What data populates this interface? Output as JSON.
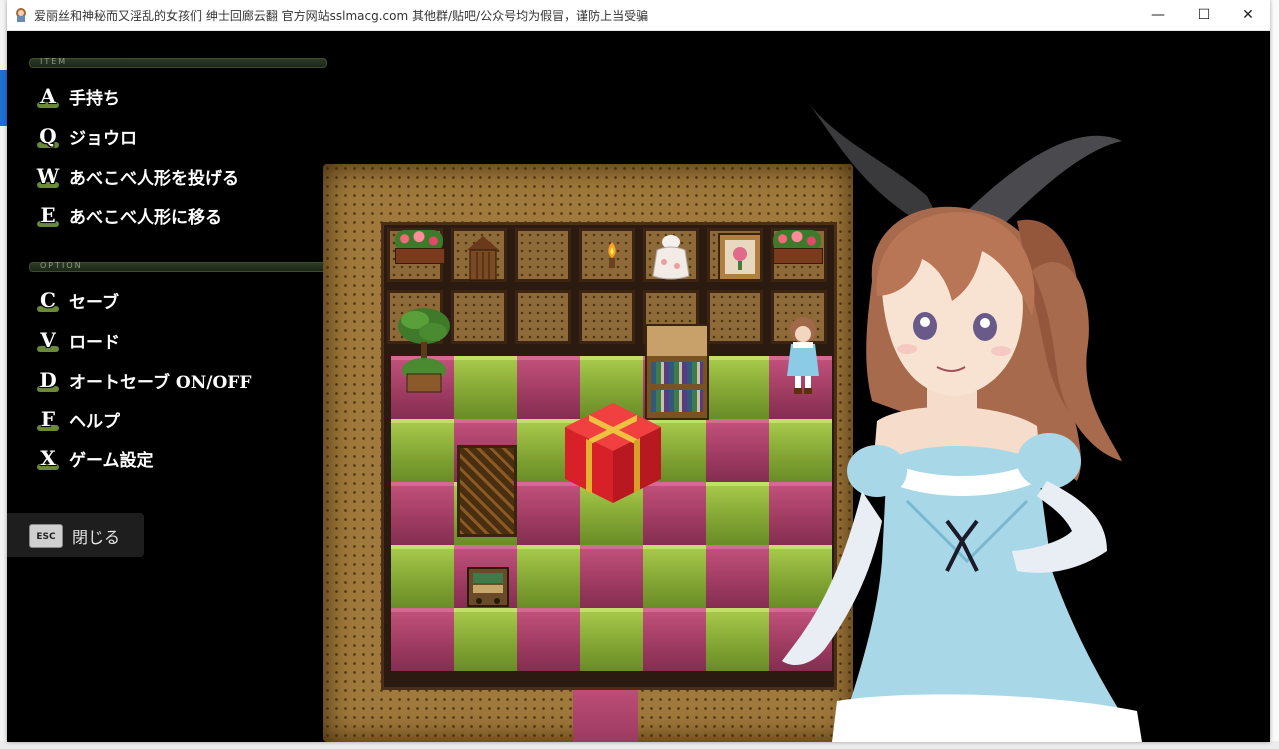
{
  "window": {
    "title": "爱丽丝和神秘而又淫乱的女孩们 绅士回廊云翻 官方网站sslmacg.com 其他群/贴吧/公众号均为假冒，谨防上当受骗",
    "minimize_glyph": "—",
    "maximize_glyph": "☐",
    "close_glyph": "✕"
  },
  "menu": {
    "item_section": "ITEM",
    "items": [
      {
        "key": "A",
        "label": "手持ち"
      },
      {
        "key": "Q",
        "label": "ジョウロ"
      },
      {
        "key": "W",
        "label": "あべこべ人形を投げる"
      },
      {
        "key": "E",
        "label": "あべこべ人形に移る"
      }
    ],
    "option_section": "OPTION",
    "options": [
      {
        "key": "C",
        "label": "セーブ"
      },
      {
        "key": "V",
        "label": "ロード"
      },
      {
        "key": "D",
        "label": "オートセーブ ON/OFF"
      },
      {
        "key": "F",
        "label": "ヘルプ"
      },
      {
        "key": "X",
        "label": "ゲーム設定"
      }
    ],
    "close_key": "ESC",
    "close_label": "閉じる"
  },
  "colors": {
    "tile_green": "#8fb23a",
    "tile_pink": "#a8406a",
    "gift_red": "#e0202a",
    "gift_ribbon": "#f0c040",
    "dress_blue": "#a8d8e8"
  }
}
